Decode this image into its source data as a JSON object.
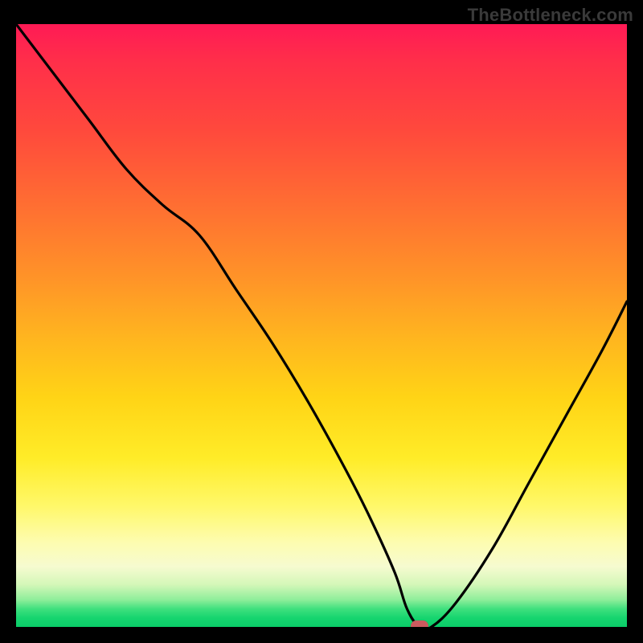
{
  "watermark": "TheBottleneck.com",
  "colors": {
    "background": "#000000",
    "curve": "#000000",
    "marker": "#cc5a5f"
  },
  "chart_data": {
    "type": "line",
    "title": "",
    "xlabel": "",
    "ylabel": "",
    "xlim": [
      0,
      100
    ],
    "ylim": [
      0,
      100
    ],
    "note": "x is horizontal position in %, y is bottleneck percentage (0 at bottom, 100 at top). Curve descends from top-left to a minimum near x≈66 then rises toward the right.",
    "series": [
      {
        "name": "bottleneck-curve",
        "x": [
          0,
          6,
          12,
          18,
          24,
          30,
          36,
          42,
          48,
          54,
          58,
          62,
          64,
          66,
          68,
          72,
          78,
          84,
          90,
          96,
          100
        ],
        "y": [
          100,
          92,
          84,
          76,
          70,
          65,
          56,
          47,
          37,
          26,
          18,
          9,
          3,
          0,
          0,
          4,
          13,
          24,
          35,
          46,
          54
        ]
      }
    ],
    "annotations": [
      {
        "name": "optimal-marker",
        "x": 66,
        "y": 0
      }
    ],
    "gradient_stops": [
      {
        "pos": 0,
        "color": "#ff1a55"
      },
      {
        "pos": 0.3,
        "color": "#ff6e32"
      },
      {
        "pos": 0.62,
        "color": "#ffd416"
      },
      {
        "pos": 0.86,
        "color": "#fdfcb0"
      },
      {
        "pos": 1.0,
        "color": "#0acc68"
      }
    ]
  }
}
